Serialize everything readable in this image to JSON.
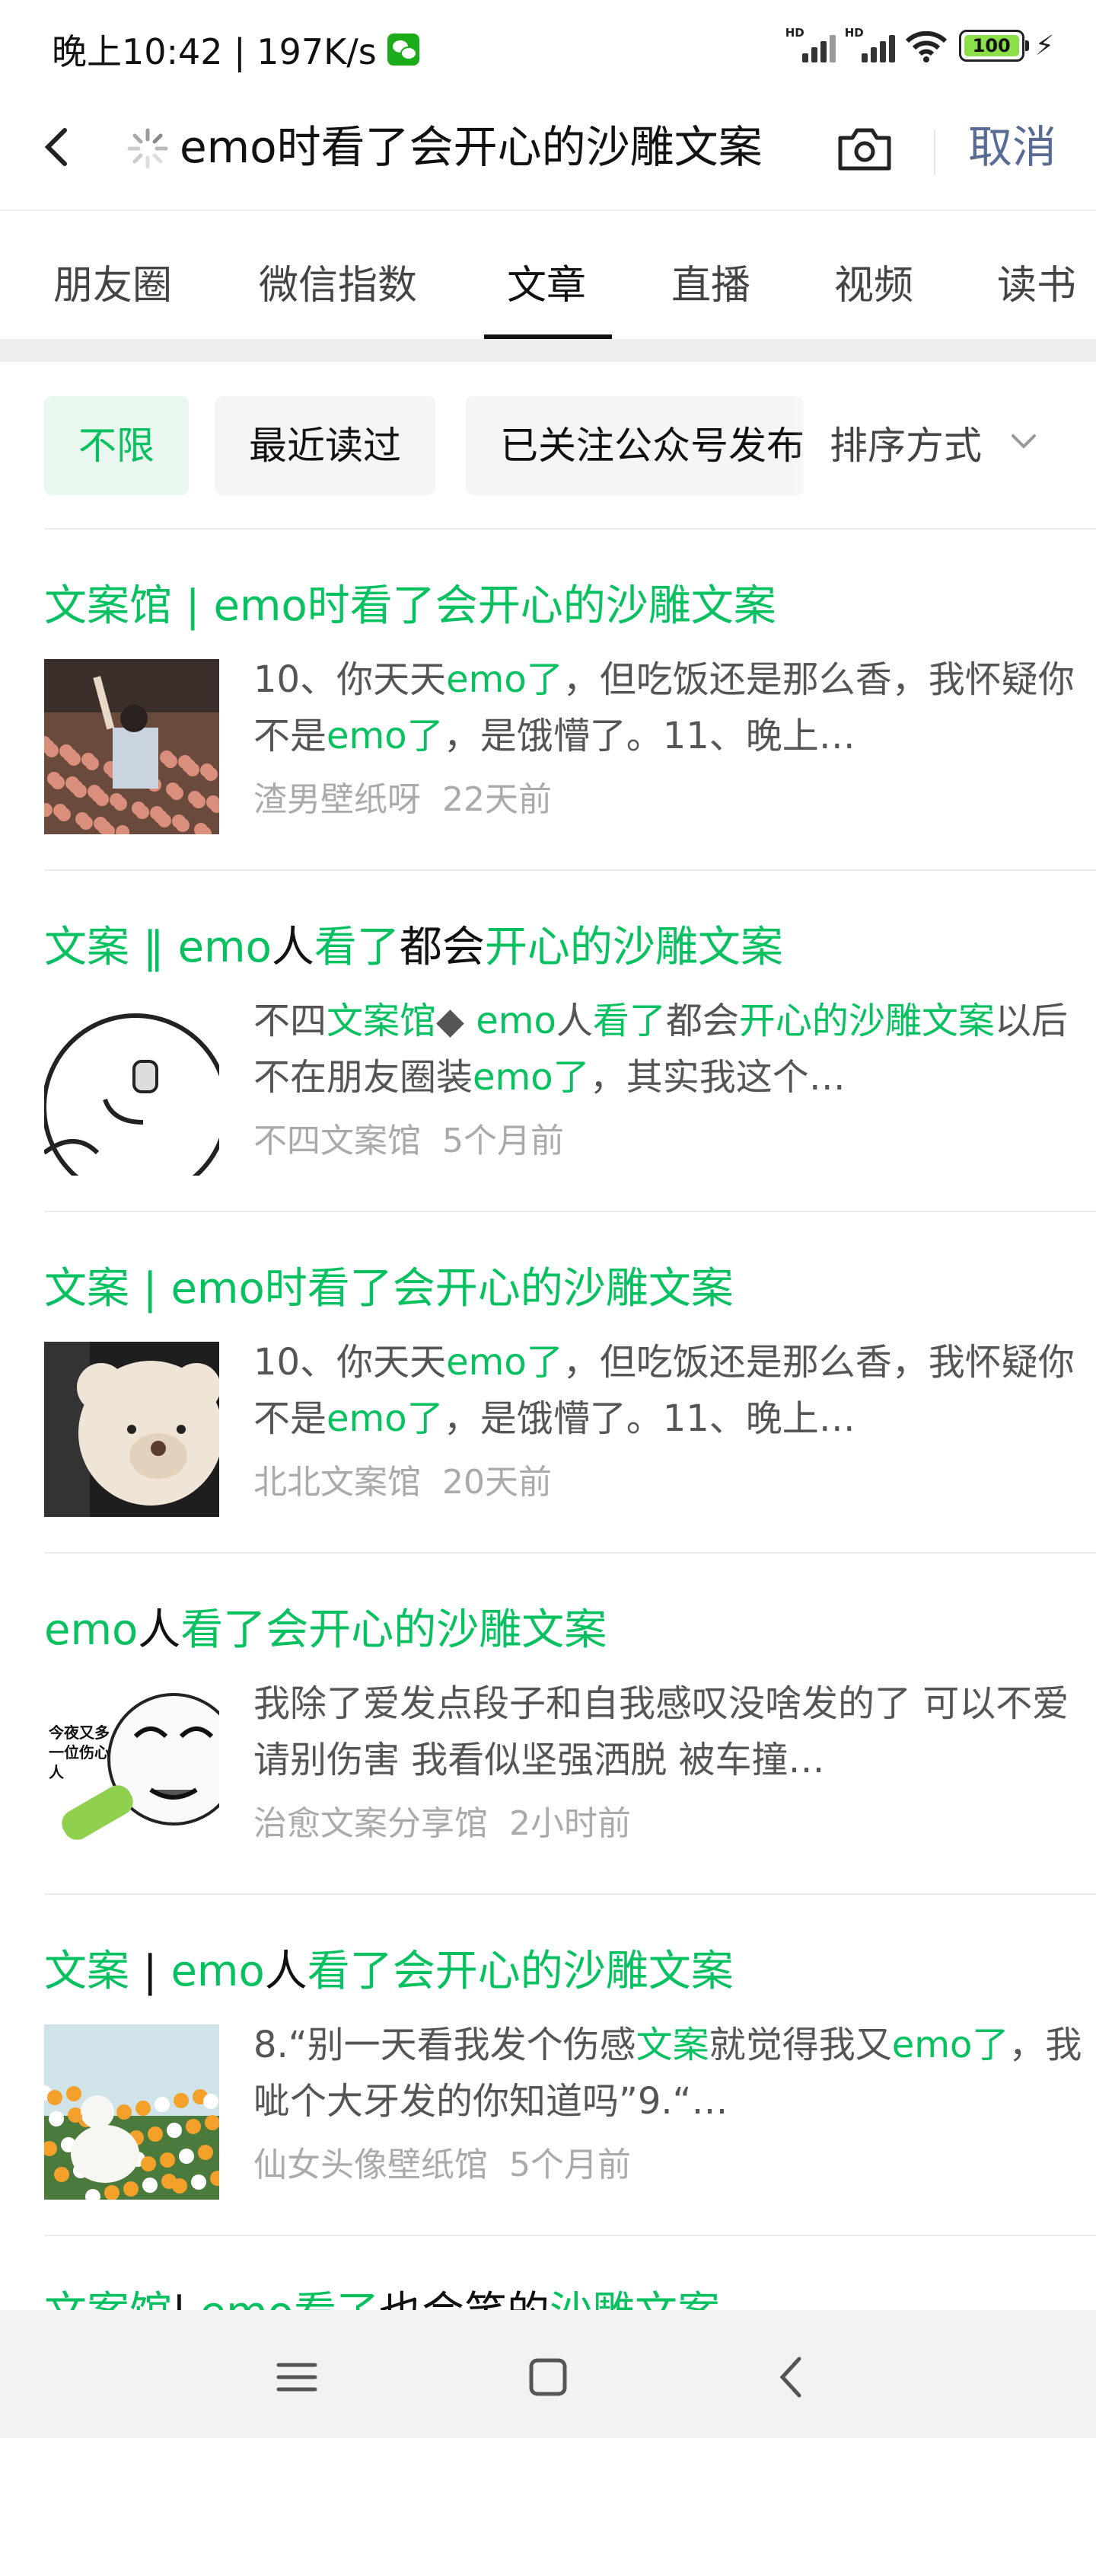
{
  "status": {
    "time_speed": "晚上10:42 | 197K/s",
    "battery": "100",
    "signal_label_1": "HD",
    "signal_label_2": "HD"
  },
  "search": {
    "query": "emo时看了会开心的沙雕文案",
    "cancel_label": "取消"
  },
  "tabs": [
    {
      "label": "朋友圈"
    },
    {
      "label": "微信指数"
    },
    {
      "label": "文章"
    },
    {
      "label": "直播"
    },
    {
      "label": "视频"
    },
    {
      "label": "读书"
    }
  ],
  "filters": {
    "chip1": "不限",
    "chip2": "最近读过",
    "chip3": "已关注公众号发布",
    "sort_label": "排序方式"
  },
  "results": [
    {
      "title_parts": [
        [
          "文案馆 | ",
          "g"
        ],
        [
          "emo时看了会开心的沙雕文案",
          "g"
        ]
      ],
      "snippet": [
        [
          "10、你天天",
          ""
        ],
        [
          "emo了",
          "g"
        ],
        [
          "，但吃饭还是那么香，我怀疑你不是",
          ""
        ],
        [
          "emo了",
          "g"
        ],
        [
          "，是饿懵了。11、晚上…",
          ""
        ]
      ],
      "source": "渣男壁纸呀",
      "time": "22天前",
      "thumb": "concert-photo"
    },
    {
      "title_parts": [
        [
          "文案 ‖ emo",
          "g"
        ],
        [
          "人",
          ""
        ],
        [
          "看了",
          "g"
        ],
        [
          "都会",
          ""
        ],
        [
          "开心的沙雕文案",
          "g"
        ]
      ],
      "snippet": [
        [
          "不四",
          ""
        ],
        [
          "文案馆",
          "g"
        ],
        [
          "◆ ",
          ""
        ],
        [
          "emo",
          "g"
        ],
        [
          "人",
          ""
        ],
        [
          "看了",
          "g"
        ],
        [
          "都会",
          ""
        ],
        [
          "开心的沙雕文案",
          "g"
        ],
        [
          "以后不在朋友圈装",
          ""
        ],
        [
          "emo了",
          "g"
        ],
        [
          "，其实我这个…",
          ""
        ]
      ],
      "source": "不四文案馆",
      "time": "5个月前",
      "thumb": "cartoon-face"
    },
    {
      "title_parts": [
        [
          "文案 | emo时看了会开心的沙雕文案",
          "g"
        ]
      ],
      "snippet": [
        [
          "10、你天天",
          ""
        ],
        [
          "emo了",
          "g"
        ],
        [
          "，但吃饭还是那么香，我怀疑你不是",
          ""
        ],
        [
          "emo了",
          "g"
        ],
        [
          "，是饿懵了。11、晚上…",
          ""
        ]
      ],
      "source": "北北文案馆",
      "time": "20天前",
      "thumb": "teddy-bear"
    },
    {
      "title_parts": [
        [
          "emo",
          "g"
        ],
        [
          "人",
          ""
        ],
        [
          "看了会开心的沙雕文案",
          "g"
        ]
      ],
      "snippet": [
        [
          "我除了爱发点段子和自我感叹没啥发的了 可以不爱 请别伤害 我看似坚强洒脱 被车撞…",
          ""
        ]
      ],
      "source": "治愈文案分享馆",
      "time": "2小时前",
      "thumb": "meme-face",
      "thumb_text": "今夜又多一位伤心人"
    },
    {
      "title_parts": [
        [
          "文案",
          "g"
        ],
        [
          " | ",
          ""
        ],
        [
          "emo",
          "g"
        ],
        [
          "人",
          ""
        ],
        [
          "看了会开心的沙雕文案",
          "g"
        ]
      ],
      "snippet": [
        [
          "8.“别一天看我发个伤感",
          ""
        ],
        [
          "文案",
          "g"
        ],
        [
          "就觉得我又",
          ""
        ],
        [
          "emo了",
          "g"
        ],
        [
          "，我呲个大牙发的你知道吗”9.“…",
          ""
        ]
      ],
      "source": "仙女头像壁纸馆",
      "time": "5个月前",
      "thumb": "duck-flowers"
    },
    {
      "title_parts": [
        [
          "文案馆",
          "g"
        ],
        [
          "| ",
          ""
        ],
        [
          "emo看了",
          "g"
        ],
        [
          "也会笑的",
          ""
        ],
        [
          "沙雕文案",
          "g"
        ]
      ],
      "snippet": [],
      "source": "",
      "time": "",
      "thumb": ""
    }
  ]
}
